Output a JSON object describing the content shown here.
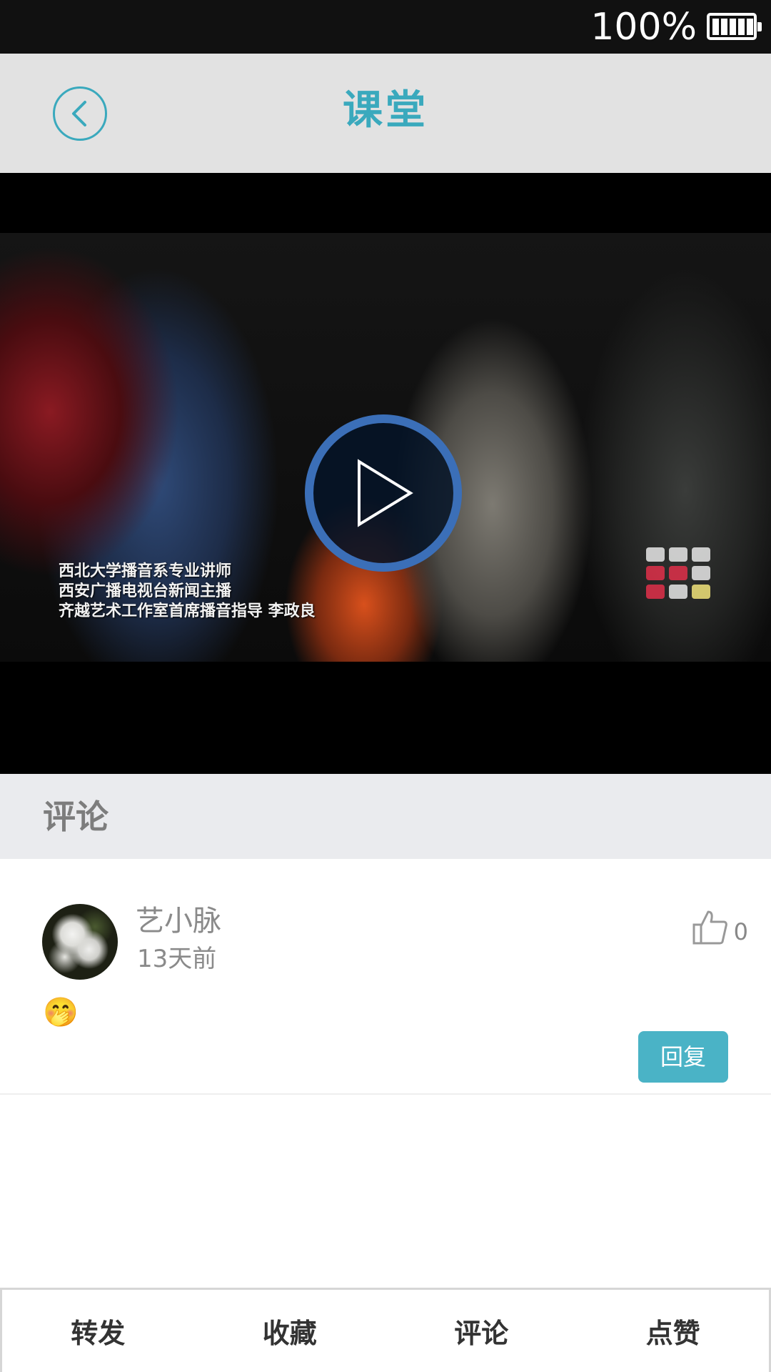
{
  "status_bar": {
    "battery_text": "100%",
    "battery_icon": "battery-full-icon"
  },
  "header": {
    "back_icon": "chevron-left-icon",
    "title": "课堂",
    "accent_color": "#3aa9bd"
  },
  "video": {
    "play_icon": "play-icon",
    "caption_lines": [
      "西北大学播音系专业讲师",
      "西安广播电视台新闻主播",
      "齐越艺术工作室首席播音指导 李政良"
    ]
  },
  "comments": {
    "section_title": "评论",
    "items": [
      {
        "username": "艺小脉",
        "time": "13天前",
        "like_icon": "thumbs-up-icon",
        "like_count": "0",
        "content": "🤭",
        "reply_label": "回复"
      }
    ]
  },
  "bottom_bar": {
    "share_label": "转发",
    "favorite_label": "收藏",
    "comment_label": "评论",
    "like_label": "点赞"
  }
}
